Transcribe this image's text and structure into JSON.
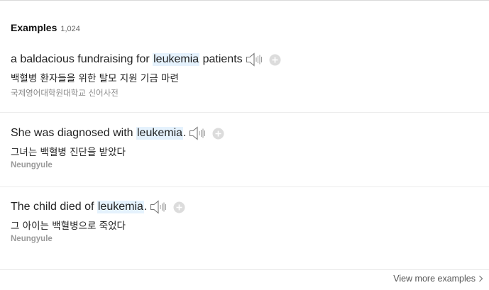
{
  "header": {
    "title": "Examples",
    "count": "1,024"
  },
  "examples": [
    {
      "before": "a baldacious fundraising for ",
      "keyword": "leukemia",
      "after": " patients",
      "translation": "백혈병 환자들을 위한 탈모 지원 기금 마련",
      "source": "국제영어대학원대학교 신어사전"
    },
    {
      "before": "She was diagnosed with ",
      "keyword": "leukemia",
      "after": ".",
      "translation": "그녀는 백혈병 진단을 받았다",
      "source": "Neungyule"
    },
    {
      "before": "The child died of ",
      "keyword": "leukemia",
      "after": ".",
      "translation": "그 아이는 백혈병으로 죽었다",
      "source": "Neungyule"
    }
  ],
  "footer": {
    "view_more_label": "View more examples"
  },
  "icons": {
    "speaker": "speaker-icon",
    "add": "plus-circle-icon",
    "more": "chevron-right-icon"
  },
  "colors": {
    "highlight": "#e5f2fd",
    "muted": "#8a8a8a"
  }
}
